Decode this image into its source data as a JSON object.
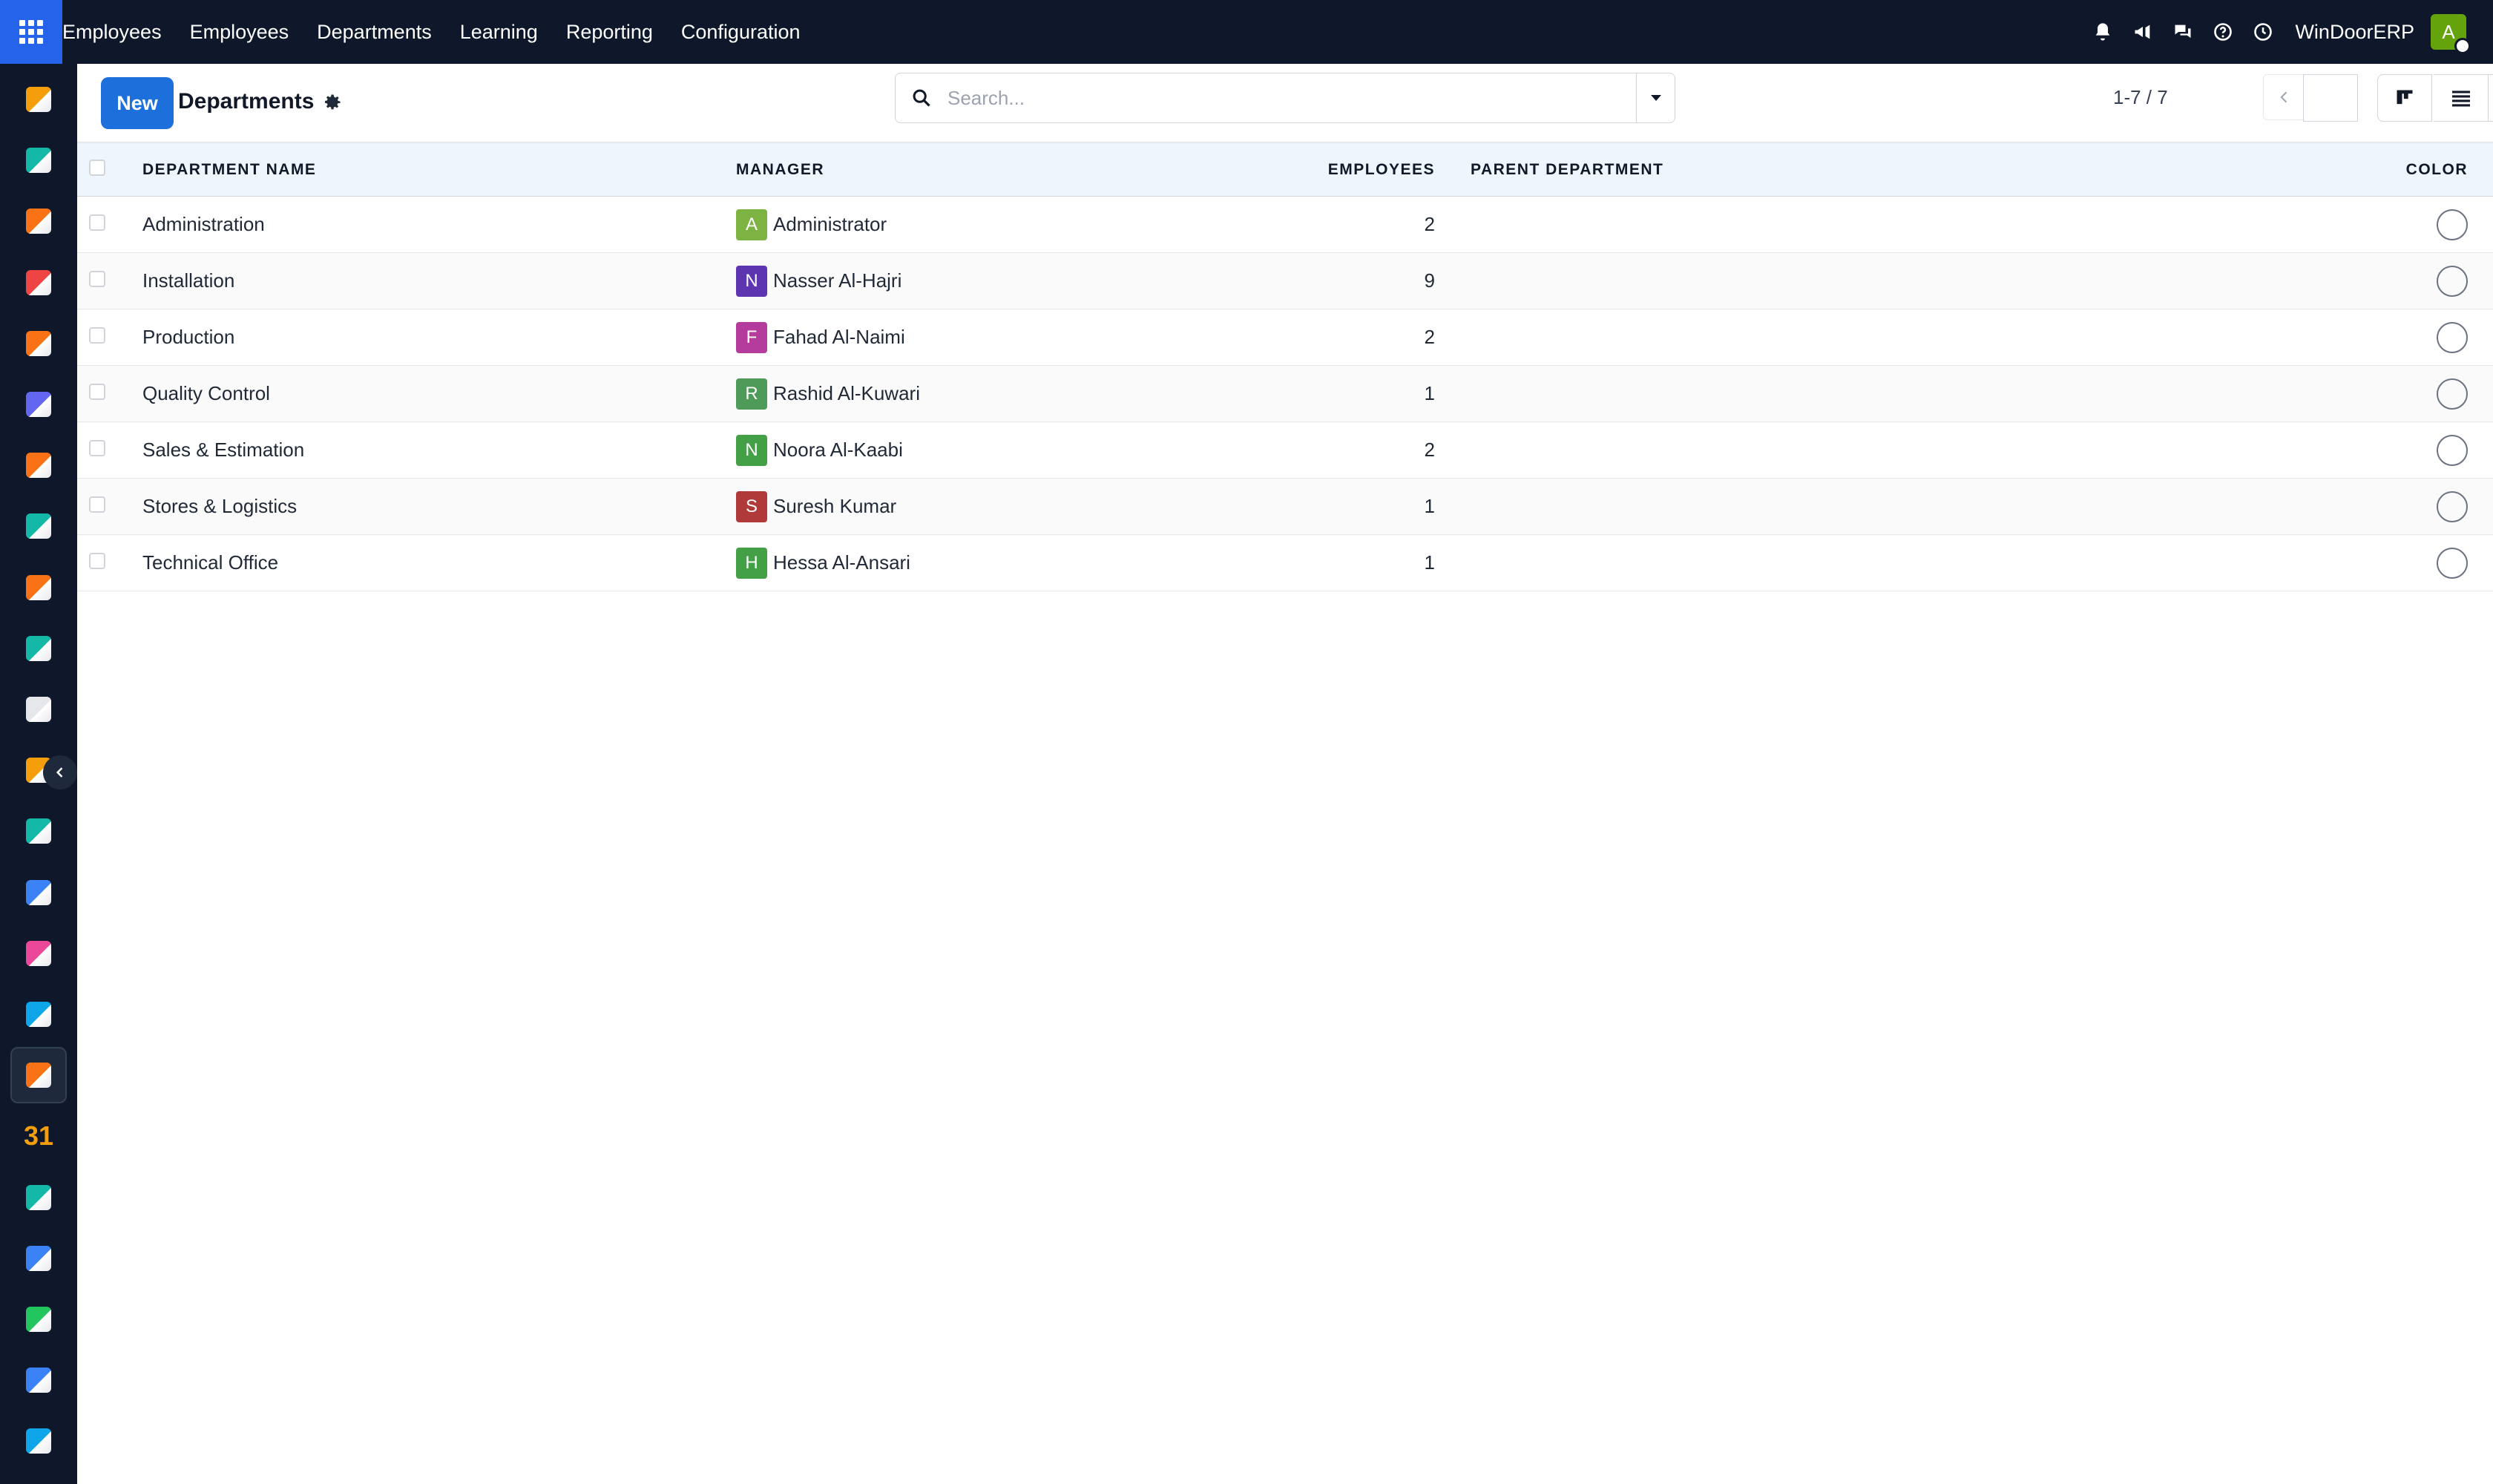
{
  "navbar": {
    "app_name": "Employees",
    "menu": [
      "Employees",
      "Departments",
      "Learning",
      "Reporting",
      "Configuration"
    ],
    "company": "WinDoorERP",
    "user_initial": "A",
    "icons": [
      "bell-icon",
      "megaphone-icon",
      "chat-icon",
      "help-icon",
      "clock-icon"
    ]
  },
  "sidebar": {
    "apps": [
      {
        "name": "app-1",
        "color": "#f59e0b"
      },
      {
        "name": "app-contacts",
        "color": "#14b8a6"
      },
      {
        "name": "app-reports",
        "color": "#f97316"
      },
      {
        "name": "app-pie",
        "color": "#ef4444"
      },
      {
        "name": "app-chat",
        "color": "#f97316"
      },
      {
        "name": "app-mail",
        "color": "#6366f1"
      },
      {
        "name": "app-discuss",
        "color": "#f97316"
      },
      {
        "name": "app-check",
        "color": "#14b8a6"
      },
      {
        "name": "app-charts",
        "color": "#f97316"
      },
      {
        "name": "app-contacts-2",
        "color": "#14b8a6"
      },
      {
        "name": "app-inventory",
        "color": "#e5e7eb"
      },
      {
        "name": "app-tools",
        "color": "#f59e0b"
      },
      {
        "name": "app-tasks",
        "color": "#14b8a6"
      },
      {
        "name": "app-knowledge",
        "color": "#3b82f6"
      },
      {
        "name": "app-box",
        "color": "#ec4899"
      },
      {
        "name": "app-billing",
        "color": "#0ea5e9"
      },
      {
        "name": "app-employees",
        "color": "#f97316"
      },
      {
        "name": "app-calendar",
        "label": "31",
        "color": "#f59e0b"
      },
      {
        "name": "app-sign",
        "color": "#14b8a6"
      },
      {
        "name": "app-dashboard",
        "color": "#3b82f6"
      },
      {
        "name": "app-whatsapp",
        "color": "#22c55e"
      },
      {
        "name": "app-clock",
        "color": "#3b82f6"
      },
      {
        "name": "app-waves",
        "color": "#0ea5e9"
      }
    ]
  },
  "control": {
    "new_label": "New",
    "title": "Departments",
    "search_placeholder": "Search...",
    "pager": "1-7 / 7"
  },
  "table": {
    "headers": {
      "name": "DEPARTMENT NAME",
      "manager": "MANAGER",
      "employees": "EMPLOYEES",
      "parent": "PARENT DEPARTMENT",
      "color": "COLOR"
    },
    "rows": [
      {
        "name": "Administration",
        "manager": "Administrator",
        "initial": "A",
        "avatar_color": "#7cb342",
        "employees": "2",
        "parent": ""
      },
      {
        "name": "Installation",
        "manager": "Nasser Al-Hajri",
        "initial": "N",
        "avatar_color": "#5e35b1",
        "employees": "9",
        "parent": ""
      },
      {
        "name": "Production",
        "manager": "Fahad Al-Naimi",
        "initial": "F",
        "avatar_color": "#b43c9c",
        "employees": "2",
        "parent": ""
      },
      {
        "name": "Quality Control",
        "manager": "Rashid Al-Kuwari",
        "initial": "R",
        "avatar_color": "#4e9a59",
        "employees": "1",
        "parent": ""
      },
      {
        "name": "Sales & Estimation",
        "manager": "Noora Al-Kaabi",
        "initial": "N",
        "avatar_color": "#43a047",
        "employees": "2",
        "parent": ""
      },
      {
        "name": "Stores & Logistics",
        "manager": "Suresh Kumar",
        "initial": "S",
        "avatar_color": "#b03a3a",
        "employees": "1",
        "parent": ""
      },
      {
        "name": "Technical Office",
        "manager": "Hessa Al-Ansari",
        "initial": "H",
        "avatar_color": "#43a047",
        "employees": "1",
        "parent": ""
      }
    ]
  }
}
